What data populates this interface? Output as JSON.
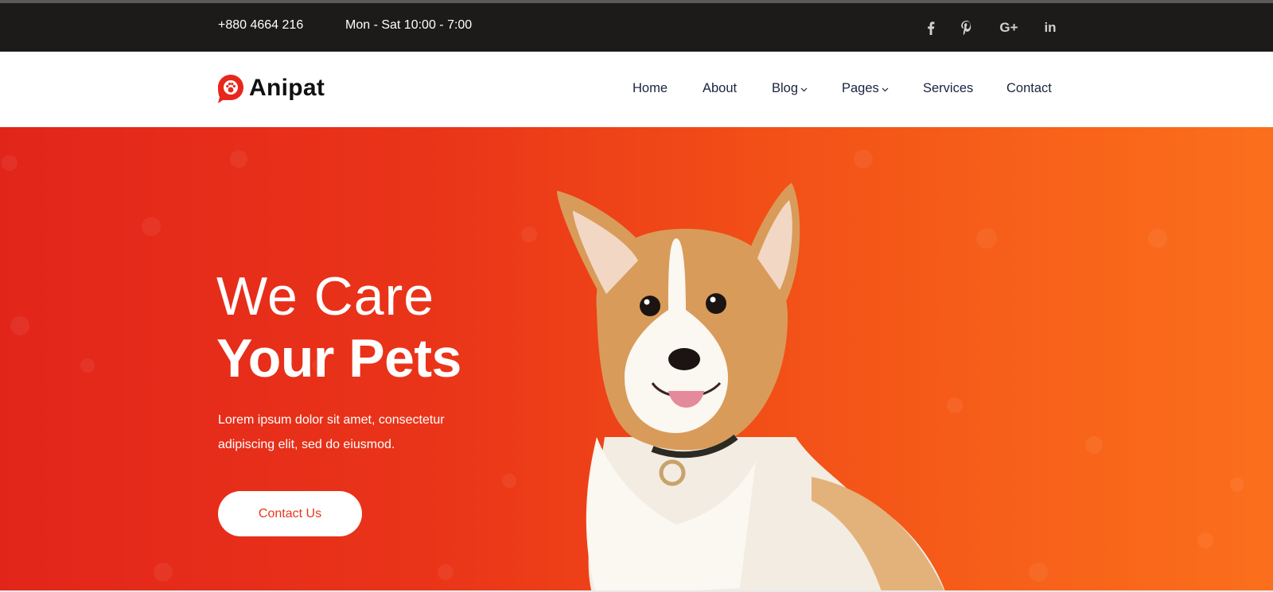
{
  "topbar": {
    "phone": "+880 4664 216",
    "hours": "Mon - Sat 10:00 - 7:00",
    "socials": [
      {
        "icon": "facebook-icon"
      },
      {
        "icon": "pinterest-icon"
      },
      {
        "icon": "google-plus-icon",
        "glyph": "G+"
      },
      {
        "icon": "linkedin-icon",
        "glyph": "in"
      }
    ]
  },
  "nav": {
    "logo_text": "Anipat",
    "items": [
      {
        "label": "Home"
      },
      {
        "label": "About"
      },
      {
        "label": "Blog",
        "has_dropdown": true
      },
      {
        "label": "Pages",
        "has_dropdown": true
      },
      {
        "label": "Services"
      },
      {
        "label": "Contact"
      }
    ]
  },
  "hero": {
    "title_light": "We Care",
    "title_bold": "Your Pets",
    "description": "Lorem ipsum dolor sit amet, consectetur adipiscing elit, sed do eiusmod.",
    "cta_label": "Contact Us"
  },
  "colors": {
    "topbar_bg": "#1d1a1a",
    "hero_gradient_start": "#e2251a",
    "hero_gradient_end": "#fb6f1c",
    "cta_text": "#e8361c",
    "nav_text": "#1a2440",
    "logo_mark": "#e8271c"
  }
}
